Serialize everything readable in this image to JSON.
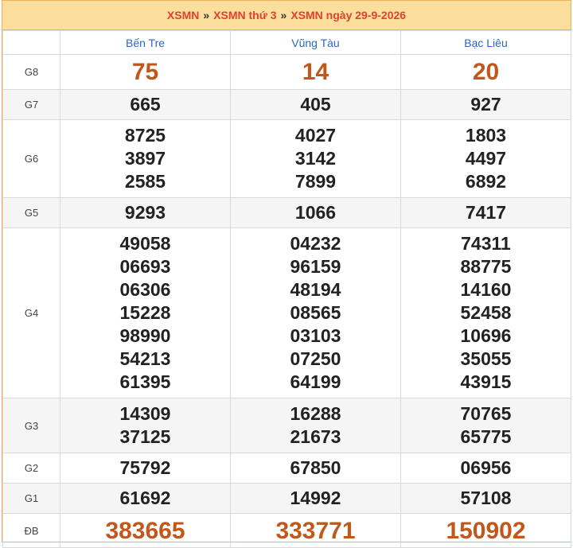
{
  "breadcrumb": {
    "items": [
      "XSMN",
      "XSMN thứ 3",
      "XSMN ngày 29-9-2026"
    ],
    "separator": "»"
  },
  "provinces": [
    "Bến Tre",
    "Vũng Tàu",
    "Bạc Liêu"
  ],
  "prizes": [
    {
      "label": "G8",
      "results": [
        [
          "75"
        ],
        [
          "14"
        ],
        [
          "20"
        ]
      ]
    },
    {
      "label": "G7",
      "results": [
        [
          "665"
        ],
        [
          "405"
        ],
        [
          "927"
        ]
      ]
    },
    {
      "label": "G6",
      "results": [
        [
          "8725",
          "3897",
          "2585"
        ],
        [
          "4027",
          "3142",
          "7899"
        ],
        [
          "1803",
          "4497",
          "6892"
        ]
      ]
    },
    {
      "label": "G5",
      "results": [
        [
          "9293"
        ],
        [
          "1066"
        ],
        [
          "7417"
        ]
      ]
    },
    {
      "label": "G4",
      "results": [
        [
          "49058",
          "06693",
          "06306",
          "15228",
          "98990",
          "54213",
          "61395"
        ],
        [
          "04232",
          "96159",
          "48194",
          "08565",
          "03103",
          "07250",
          "64199"
        ],
        [
          "74311",
          "88775",
          "14160",
          "52458",
          "10696",
          "35055",
          "43915"
        ]
      ]
    },
    {
      "label": "G3",
      "results": [
        [
          "14309",
          "37125"
        ],
        [
          "16288",
          "21673"
        ],
        [
          "70765",
          "65775"
        ]
      ]
    },
    {
      "label": "G2",
      "results": [
        [
          "75792"
        ],
        [
          "67850"
        ],
        [
          "06956"
        ]
      ]
    },
    {
      "label": "G1",
      "results": [
        [
          "61692"
        ],
        [
          "14992"
        ],
        [
          "57108"
        ]
      ]
    },
    {
      "label": "ĐB",
      "results": [
        [
          "383665"
        ],
        [
          "333771"
        ],
        [
          "150902"
        ]
      ]
    }
  ],
  "colors": {
    "header_bg": "#fcdf9d",
    "crumb_text": "#e2402f",
    "province_text": "#2a67c7",
    "highlight_number": "#c2571b",
    "border": "#f2b25a"
  }
}
